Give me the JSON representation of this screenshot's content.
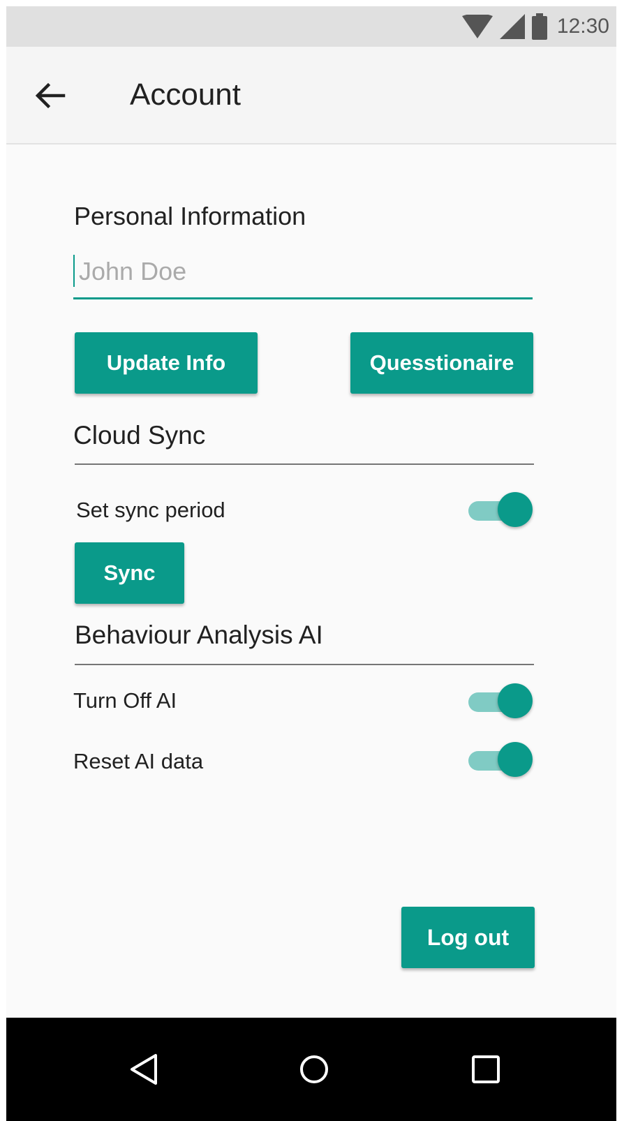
{
  "status_bar": {
    "time": "12:30",
    "icons": [
      "wifi-icon",
      "signal-icon",
      "battery-icon"
    ]
  },
  "app_bar": {
    "back_icon": "arrow-back-icon",
    "title": "Account"
  },
  "personal_info": {
    "title": "Personal Information",
    "name_placeholder": "John Doe",
    "name_value": "",
    "update_button": "Update Info",
    "questionnaire_button": "Quesstionaire"
  },
  "cloud_sync": {
    "title": "Cloud Sync",
    "sync_period_label": "Set sync period",
    "sync_period_on": true,
    "sync_button": "Sync"
  },
  "behaviour_ai": {
    "title": "Behaviour Analysis AI",
    "turn_off_label": "Turn Off AI",
    "turn_off_on": true,
    "reset_label": "Reset AI data",
    "reset_on": true
  },
  "logout_button": "Log out",
  "nav_bar": {
    "icons": [
      "back-triangle-icon",
      "home-circle-icon",
      "recents-square-icon"
    ]
  },
  "colors": {
    "accent": "#0a9a8a",
    "track": "#80cbc4",
    "status_bar": "#e0e0e0",
    "app_bar": "#f5f5f5"
  }
}
